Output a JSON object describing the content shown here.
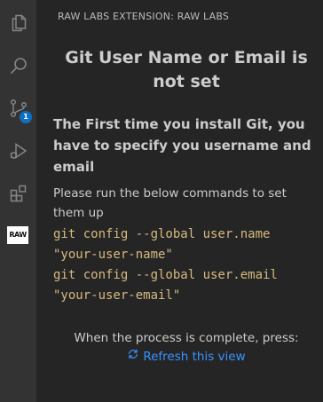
{
  "activity_bar": {
    "items": [
      {
        "icon": "files-icon"
      },
      {
        "icon": "search-icon"
      },
      {
        "icon": "source-control-icon",
        "badge": "1"
      },
      {
        "icon": "run-debug-icon"
      },
      {
        "icon": "extensions-icon"
      },
      {
        "icon": "raw-labs-icon",
        "logo_text": "RAW"
      }
    ]
  },
  "sidebar": {
    "header": "RAW LABS EXTENSION: RAW LABS",
    "title": "Git User Name or Email is not set",
    "subtitle": "The First time you install Git, you have to specify you username and email",
    "description": "Please run the below commands to set them up",
    "code_lines": [
      "git config --global user.name",
      "\"your-user-name\"",
      "git config --global user.email",
      "\"your-user-email\""
    ],
    "complete_text": "When the process is complete, press:",
    "refresh_label": "Refresh this view"
  },
  "colors": {
    "activity_bar_bg": "#333333",
    "sidebar_bg": "#252526",
    "text": "#cccccc",
    "code": "#d7ba7d",
    "link": "#3794ff",
    "badge": "#0e70c0"
  }
}
